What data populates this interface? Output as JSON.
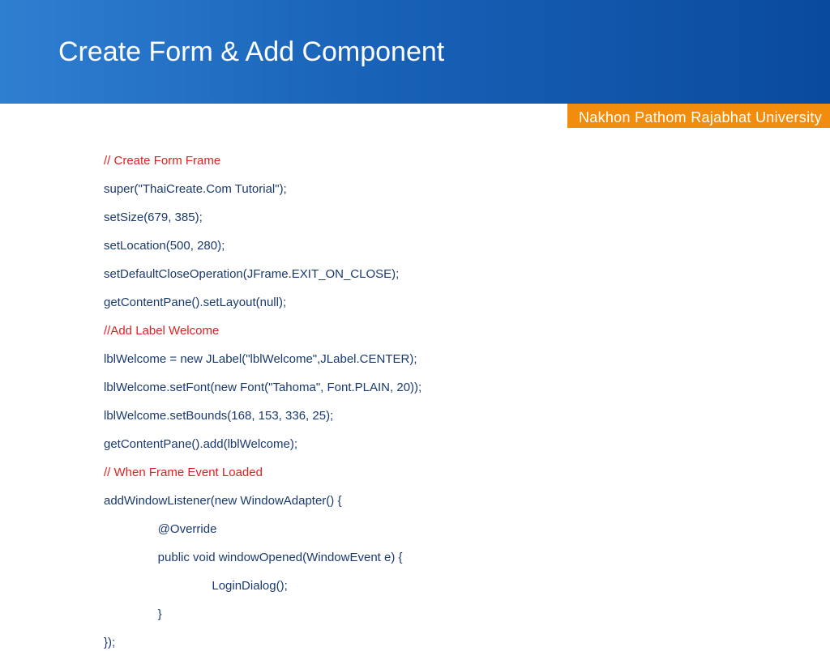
{
  "header": {
    "title": "Create Form & Add Component"
  },
  "badge": {
    "text": "Nakhon Pathom Rajabhat University"
  },
  "code": {
    "lines": [
      {
        "text": "// Create Form Frame",
        "type": "comment",
        "indent": 0
      },
      {
        "text": "super(\"ThaiCreate.Com Tutorial\");",
        "type": "code",
        "indent": 0
      },
      {
        "text": "setSize(679, 385);",
        "type": "code",
        "indent": 0
      },
      {
        "text": "setLocation(500, 280);",
        "type": "code",
        "indent": 0
      },
      {
        "text": "setDefaultCloseOperation(JFrame.EXIT_ON_CLOSE);",
        "type": "code",
        "indent": 0
      },
      {
        "text": "getContentPane().setLayout(null);",
        "type": "code",
        "indent": 0
      },
      {
        "text": "//Add Label Welcome",
        "type": "comment",
        "indent": 0
      },
      {
        "text": "lblWelcome = new JLabel(\"lblWelcome\",JLabel.CENTER);",
        "type": "code",
        "indent": 0
      },
      {
        "text": "lblWelcome.setFont(new Font(\"Tahoma\", Font.PLAIN, 20));",
        "type": "code",
        "indent": 0
      },
      {
        "text": "lblWelcome.setBounds(168, 153, 336, 25);",
        "type": "code",
        "indent": 0
      },
      {
        "text": "getContentPane().add(lblWelcome);",
        "type": "code",
        "indent": 0
      },
      {
        "text": "// When Frame Event Loaded",
        "type": "comment",
        "indent": 0
      },
      {
        "text": "addWindowListener(new WindowAdapter() {",
        "type": "code",
        "indent": 0
      },
      {
        "text": "@Override",
        "type": "code",
        "indent": 1
      },
      {
        "text": "public void windowOpened(WindowEvent e) {",
        "type": "code",
        "indent": 1
      },
      {
        "text": "LoginDialog();",
        "type": "code",
        "indent": 2
      },
      {
        "text": "}",
        "type": "code",
        "indent": 1
      },
      {
        "text": "});",
        "type": "code",
        "indent": 0
      }
    ]
  }
}
